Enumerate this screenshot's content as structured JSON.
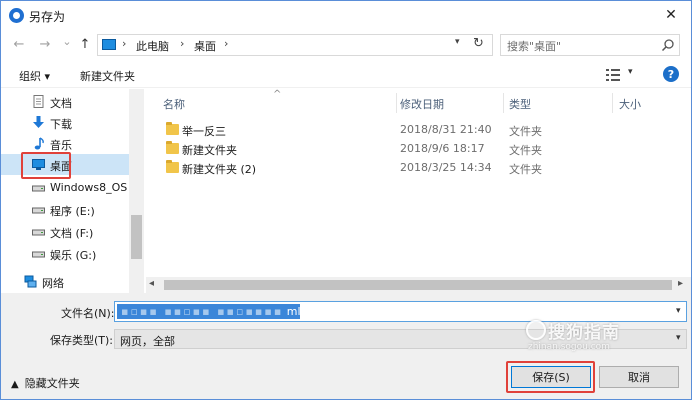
{
  "title_bar": {
    "title": "另存为",
    "close_label": "✕"
  },
  "nav": {
    "back_icon": "←",
    "forward_icon": "→",
    "recent_icon": "⌄",
    "up_icon": "↑",
    "address_segments": [
      "此电脑",
      "桌面"
    ],
    "search_placeholder": "搜索\"桌面\""
  },
  "toolbar": {
    "organize_label": "组织 ▾",
    "new_folder_label": "新建文件夹"
  },
  "sidebar": {
    "items": [
      {
        "label": "文档",
        "icon": "document-icon"
      },
      {
        "label": "下载",
        "icon": "download-icon"
      },
      {
        "label": "音乐",
        "icon": "music-icon"
      },
      {
        "label": "桌面",
        "icon": "desktop-icon",
        "selected": true
      },
      {
        "label": "Windows8_OS",
        "icon": "drive-icon"
      },
      {
        "label": "程序 (E:)",
        "icon": "drive-icon"
      },
      {
        "label": "文档 (F:)",
        "icon": "drive-icon"
      },
      {
        "label": "娱乐 (G:)",
        "icon": "drive-icon"
      },
      {
        "label": "网络",
        "icon": "network-icon"
      }
    ]
  },
  "file_list": {
    "columns": [
      "名称",
      "修改日期",
      "类型",
      "大小"
    ],
    "rows": [
      {
        "name": "举一反三",
        "date": "2018/8/31 21:40",
        "type": "文件夹"
      },
      {
        "name": "新建文件夹",
        "date": "2018/9/6 18:17",
        "type": "文件夹"
      },
      {
        "name": "新建文件夹 (2)",
        "date": "2018/3/25 14:34",
        "type": "文件夹"
      }
    ]
  },
  "form": {
    "filename_label": "文件名(N):",
    "filename_value": "ml",
    "filetype_label": "保存类型(T):",
    "filetype_value": "网页，全部"
  },
  "footer": {
    "hide_folders_label": "隐藏文件夹",
    "save_label": "保存(S)",
    "cancel_label": "取消"
  },
  "watermark": {
    "brand": "搜狗指南",
    "url": "zhinan.sogou.com"
  },
  "colors": {
    "selection_blue": "#cce4f7",
    "highlight_red": "#e0413a",
    "accent_blue": "#0078d7"
  }
}
